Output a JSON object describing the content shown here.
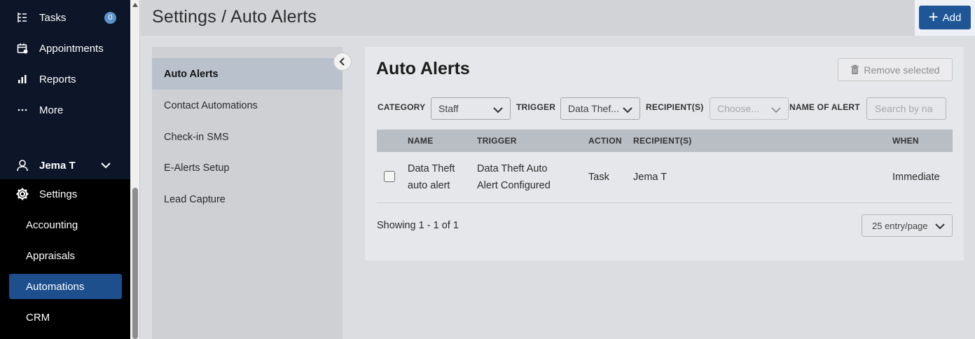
{
  "nav": {
    "items": [
      {
        "label": "Tasks",
        "badge": "0",
        "icon": "tasks-icon"
      },
      {
        "label": "Appointments",
        "icon": "calendar-icon"
      },
      {
        "label": "Reports",
        "icon": "bar-chart-icon"
      },
      {
        "label": "More",
        "icon": "ellipsis-icon"
      }
    ],
    "user": {
      "name": "Jema T",
      "icon": "user-icon"
    },
    "settings": {
      "label": "Settings",
      "icon": "gear-icon"
    },
    "settings_items": [
      "Accounting",
      "Appraisals",
      "Automations",
      "CRM"
    ],
    "active_settings_item": "Automations"
  },
  "header": {
    "title": "Settings / Auto Alerts",
    "add_label": "Add"
  },
  "subnav": {
    "items": [
      "Auto Alerts",
      "Contact Automations",
      "Check-in SMS",
      "E-Alerts Setup",
      "Lead Capture"
    ],
    "active": "Auto Alerts"
  },
  "card": {
    "title": "Auto Alerts",
    "remove_label": "Remove selected",
    "filters": {
      "category_label": "CATEGORY",
      "category_value": "Staff",
      "trigger_label": "TRIGGER",
      "trigger_value": "Data Thef...",
      "recipients_label": "RECIPIENT(S)",
      "recipients_placeholder": "Choose...",
      "name_label": "NAME OF ALERT",
      "name_placeholder": "Search by na"
    },
    "table": {
      "headers": [
        "NAME",
        "TRIGGER",
        "ACTION",
        "RECIPIENT(S)",
        "WHEN"
      ],
      "rows": [
        {
          "name_line1": "Data Theft",
          "name_line2": "auto alert",
          "trigger_line1": "Data Theft Auto",
          "trigger_line2": "Alert Configured",
          "action": "Task",
          "recipients": "Jema T",
          "when": "Immediate"
        }
      ]
    },
    "showing": "Showing 1 - 1 of 1",
    "page_size": "25 entry/page"
  },
  "colors": {
    "nav_bg": "#000000",
    "active_nav": "#1c4f8c",
    "primary_button": "#1f5796",
    "badge": "#5b93c9"
  }
}
